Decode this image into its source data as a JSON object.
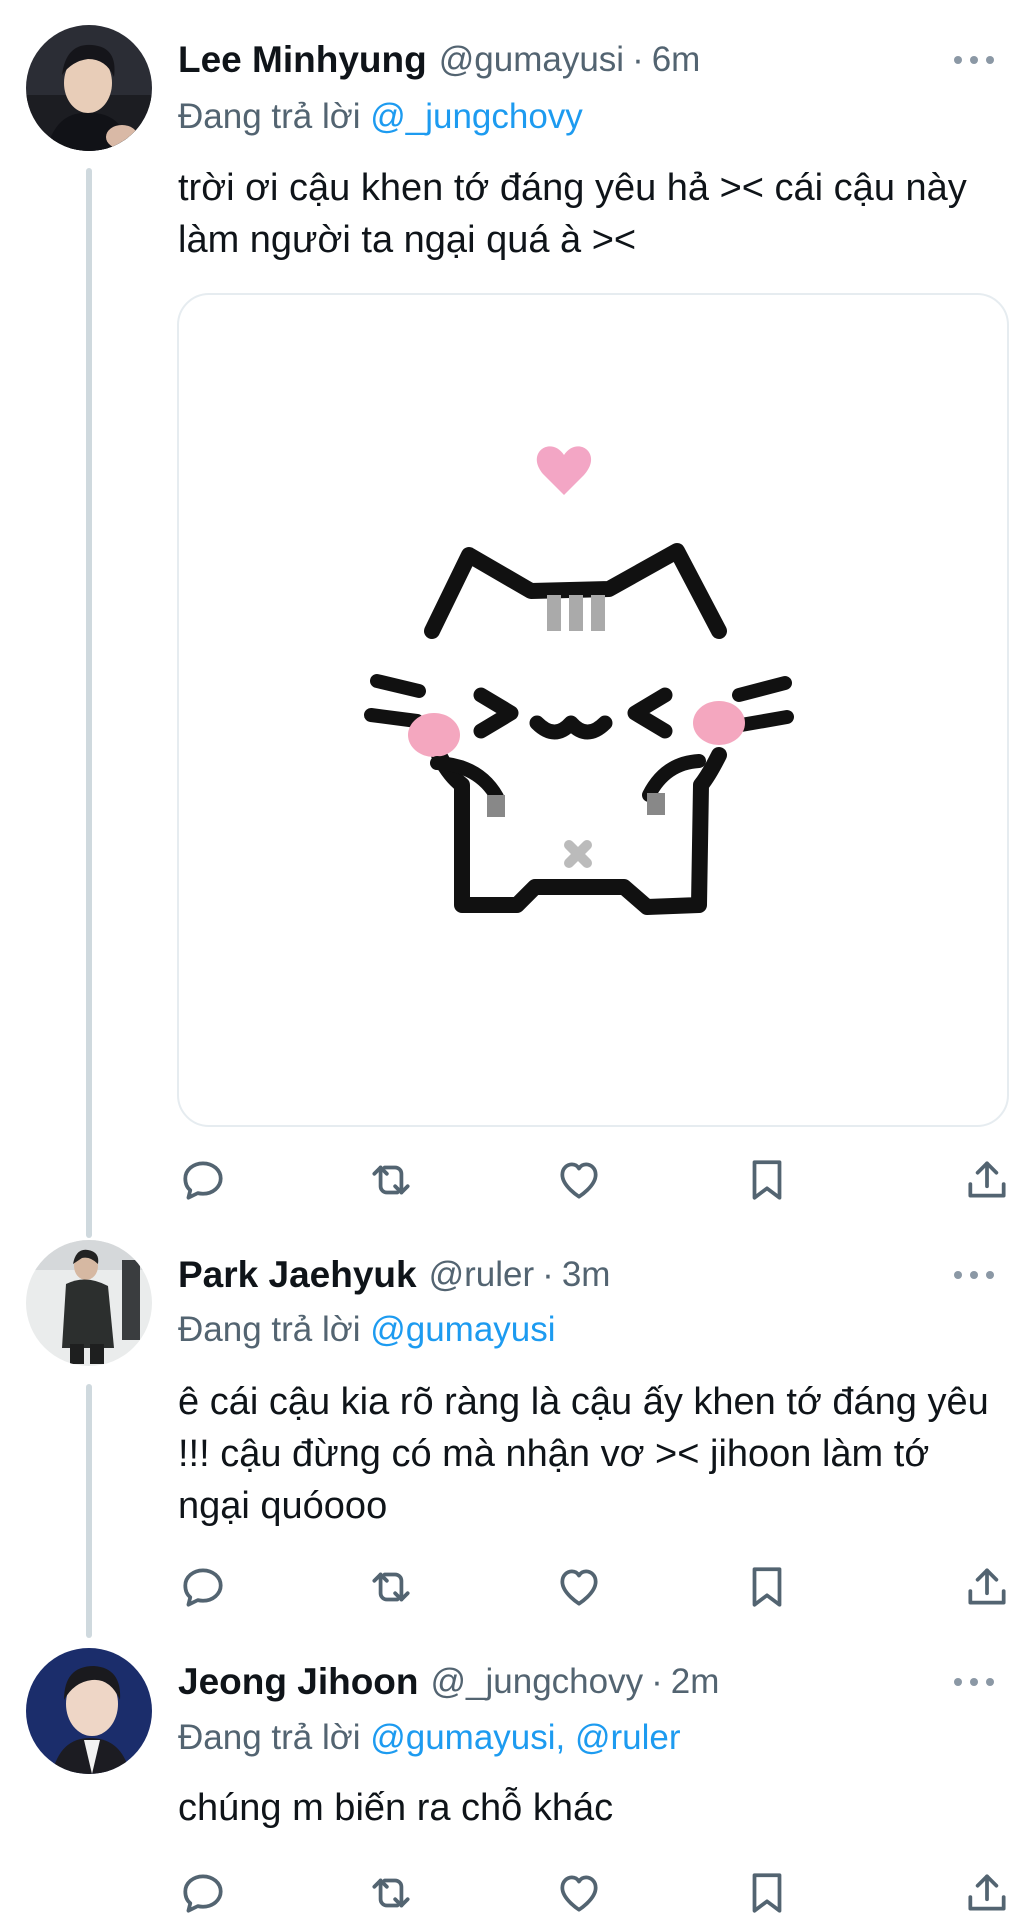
{
  "colors": {
    "mention": "#1d9bf0",
    "secondary_text": "#536471",
    "primary_text": "#0f1419",
    "thread_line": "#cfd9de",
    "icon": "#536471"
  },
  "tweets": [
    {
      "display_name": "Lee Minhyung",
      "handle": "@gumayusi",
      "separator": "·",
      "time": "6m",
      "replying_prefix": "Đang trả lời",
      "replying_to": "@_jungchovy",
      "text": "trời ơi cậu khen tớ đáng yêu hả >< cái cậu này làm người ta ngại quá à ><",
      "media": "cat-sticker-image"
    },
    {
      "display_name": "Park Jaehyuk",
      "handle": "@ruler",
      "separator": "·",
      "time": "3m",
      "replying_prefix": "Đang trả lời",
      "replying_to": "@gumayusi",
      "text": "ê cái cậu kia rõ ràng là cậu ấy khen tớ đáng yêu !!! cậu đừng có mà nhận vơ >< jihoon làm tớ ngại quóooo"
    },
    {
      "display_name": "Jeong Jihoon",
      "handle": "@_jungchovy",
      "separator": "·",
      "time": "2m",
      "replying_prefix": "Đang trả lời",
      "replying_to": "@gumayusi, @ruler",
      "text": "chúng m biến ra chỗ khác"
    }
  ],
  "action_icons": [
    "reply-icon",
    "retweet-icon",
    "like-icon",
    "bookmark-icon",
    "share-icon"
  ],
  "more_icon": "more-icon"
}
